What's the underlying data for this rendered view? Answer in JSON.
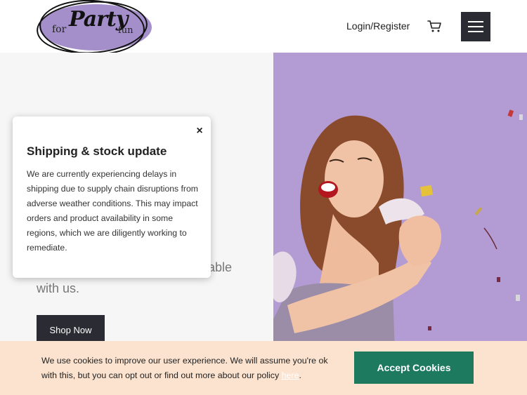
{
  "header": {
    "logo": {
      "word_for": "for",
      "word_party": "Party",
      "word_fun": "fun"
    },
    "login_label": "Login/Register",
    "cart_icon": "cart-icon",
    "menu_icon": "hamburger-menu-icon"
  },
  "hero": {
    "text_line1_fragment": "ttable",
    "text_line2": "with us.",
    "shop_button_label": "Shop Now",
    "photo_background_color": "#b39bd3"
  },
  "popup": {
    "close_label": "×",
    "title": "Shipping & stock update",
    "body": "We are currently experiencing delays in shipping due to supply chain disruptions from adverse weather conditions. This may impact orders and product availability in some regions, which we are diligently working to remediate."
  },
  "cookie_bar": {
    "text_before": "We use cookies to improve our user experience. We will assume you're ok with this, but you can opt out or find out more about our policy ",
    "link_label": "here",
    "text_after": ".",
    "accept_label": "Accept Cookies",
    "accept_color": "#1d7a5f",
    "background_color": "#fbe3cf"
  }
}
